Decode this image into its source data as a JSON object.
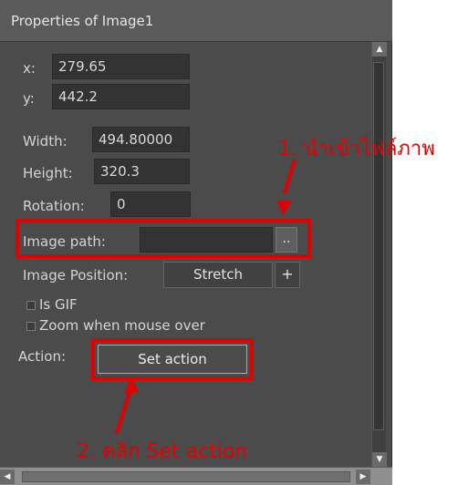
{
  "panel": {
    "title": "Properties of Image1",
    "fields": {
      "x": {
        "label": "x:",
        "value": "279.65"
      },
      "y": {
        "label": "y:",
        "value": "442.2"
      },
      "width": {
        "label": "Width:",
        "value": "494.80000"
      },
      "height": {
        "label": "Height:",
        "value": "320.3"
      },
      "rotation": {
        "label": "Rotation:",
        "value": "0"
      },
      "image_path": {
        "label": "Image path:",
        "value": ""
      },
      "image_position": {
        "label": "Image Position:",
        "value": "Stretch"
      }
    },
    "browse_label": "..",
    "plus_label": "+",
    "checkboxes": {
      "is_gif": {
        "label": "Is GIF",
        "checked": false
      },
      "zoom": {
        "label": "Zoom when mouse over",
        "checked": false
      }
    },
    "action": {
      "label": "Action:",
      "button": "Set action"
    }
  },
  "annotations": {
    "step1": "1. นำเข้าไฟล์ภาพ",
    "step2": "2. คลิก Set action"
  },
  "colors": {
    "panel_bg": "#4b4b4b",
    "highlight": "#e00000"
  },
  "icons": {
    "scroll_up": "up-arrow-icon",
    "scroll_down": "down-arrow-icon",
    "scroll_left": "left-arrow-icon",
    "scroll_right": "right-arrow-icon"
  }
}
